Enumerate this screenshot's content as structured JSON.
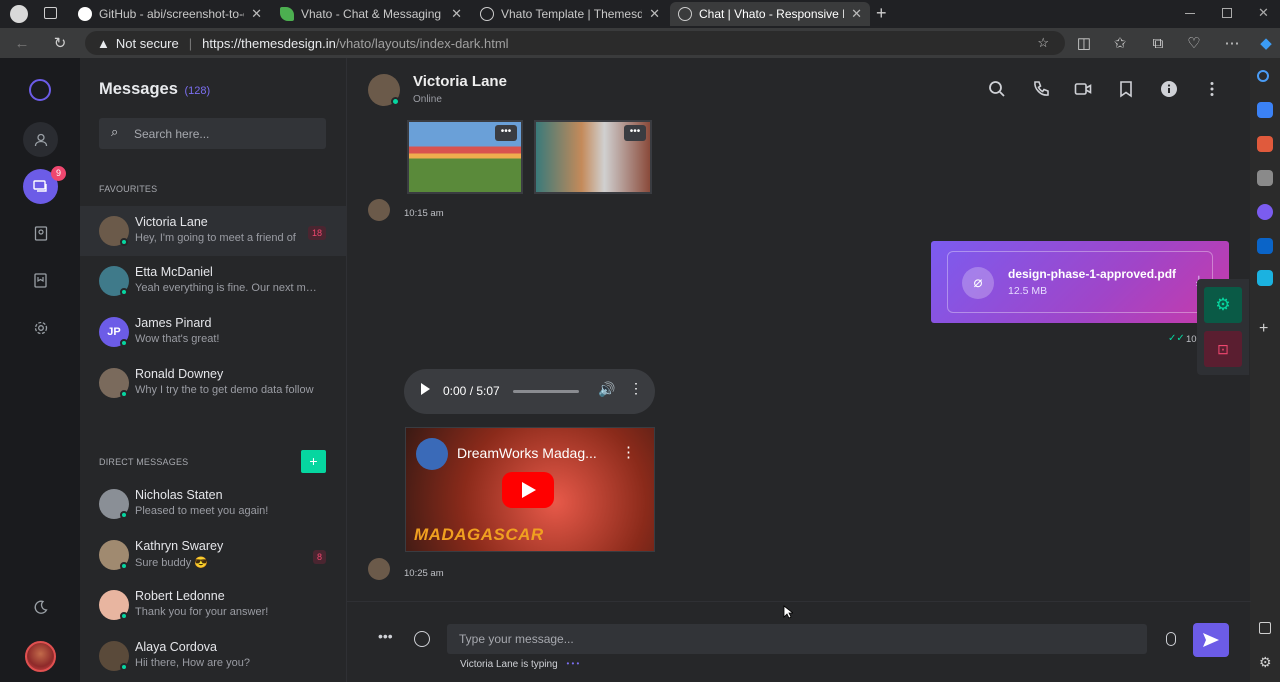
{
  "browser": {
    "tabs": [
      {
        "title": "GitHub - abi/screenshot-to-code",
        "favicon_color": "#ffffff"
      },
      {
        "title": "Vhato - Chat & Messaging HTML",
        "favicon_color": "#4caf50"
      },
      {
        "title": "Vhato Template | Themesdesign",
        "favicon_color": "#cccccc"
      },
      {
        "title": "Chat | Vhato - Responsive Bootst",
        "favicon_color": "#cccccc"
      }
    ],
    "security": "Not secure",
    "url_host": "https://themesdesign.in",
    "url_path": "/vhato/layouts/index-dark.html"
  },
  "rail": {
    "logo_icon": "chat-logo-icon",
    "notification_count": "9",
    "accent": "#6c5ce7"
  },
  "list": {
    "title": "Messages",
    "count": "(128)",
    "search_placeholder": "Search here...",
    "favourites_label": "FAVOURITES",
    "direct_label": "DIRECT MESSAGES",
    "add_label": "+",
    "favourites": [
      {
        "name": "Victoria Lane",
        "message": "Hey, I'm going to meet a friend of",
        "badge": "18",
        "avatar": "#6b5a4a"
      },
      {
        "name": "Etta McDaniel",
        "message": "Yeah everything is fine. Our next meeting",
        "badge": "",
        "avatar": "#3f7a8a"
      },
      {
        "name": "James Pinard",
        "message": "Wow that's great!",
        "badge": "",
        "avatar": "#6c5ce7",
        "initials": "JP"
      },
      {
        "name": "Ronald Downey",
        "message": "Why I try the to get demo data follow",
        "badge": "",
        "avatar": "#7a6a5c"
      }
    ],
    "direct": [
      {
        "name": "Nicholas Staten",
        "message": "Pleased to meet you again!",
        "badge": "",
        "avatar": "#8a8f96"
      },
      {
        "name": "Kathryn Swarey",
        "message": "Sure buddy 😎",
        "badge": "8",
        "avatar": "#a08a70"
      },
      {
        "name": "Robert Ledonne",
        "message": "Thank you for your answer!",
        "badge": "",
        "avatar": "#e8b5a0"
      },
      {
        "name": "Alaya Cordova",
        "message": "Hii there, How are you?",
        "badge": "",
        "avatar": "#5a4a3a"
      }
    ]
  },
  "chat": {
    "contact_name": "Victoria Lane",
    "status": "Online",
    "time1": "10:15 am",
    "file_name": "design-phase-1-approved.pdf",
    "file_size": "12.5 MB",
    "time_sent": "10",
    "audio_time": "0:00 / 5:07",
    "video_title": "DreamWorks Madag...",
    "video_logo": "MADAGASCAR",
    "time2": "10:25 am",
    "input_placeholder": "Type your message...",
    "typing": "Victoria Lane is typing",
    "typing_dots": "• • •"
  }
}
